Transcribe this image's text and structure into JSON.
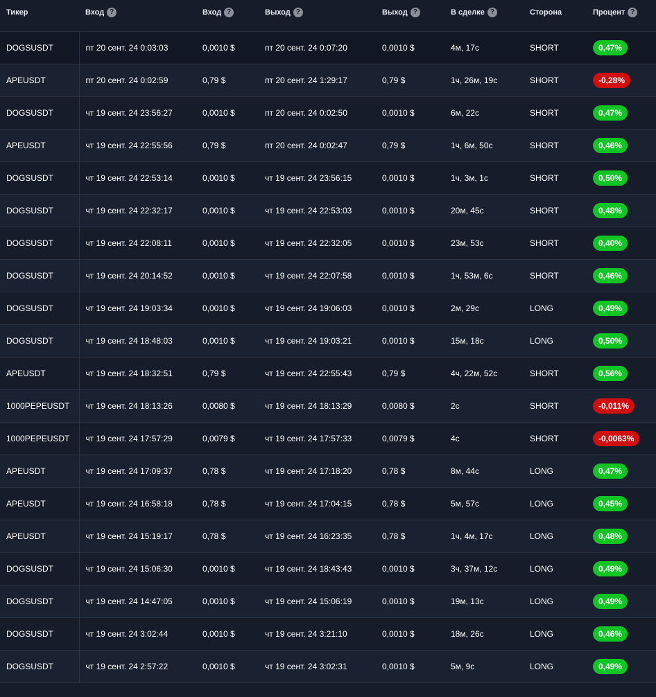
{
  "table": {
    "headers": [
      {
        "label": "Тикер",
        "help": false
      },
      {
        "label": "Вход",
        "help": true
      },
      {
        "label": "Вход",
        "help": true
      },
      {
        "label": "Выход",
        "help": true
      },
      {
        "label": "Выход",
        "help": true
      },
      {
        "label": "В сделке",
        "help": true
      },
      {
        "label": "Сторона",
        "help": false
      },
      {
        "label": "Процент",
        "help": true
      }
    ],
    "help_glyph": "?",
    "colors": {
      "positive": "#11c524",
      "negative": "#d10f0f"
    },
    "rows": [
      {
        "ticker": "DOGSUSDT",
        "entry_time": "пт 20 сент. 24 0:03:03",
        "entry_price": "0,0010 $",
        "exit_time": "пт 20 сент. 24 0:07:20",
        "exit_price": "0,0010 $",
        "duration": "4м, 17с",
        "side": "SHORT",
        "percent": "0,47%",
        "positive": true
      },
      {
        "ticker": "APEUSDT",
        "entry_time": "пт 20 сент. 24 0:02:59",
        "entry_price": "0,79 $",
        "exit_time": "пт 20 сент. 24 1:29:17",
        "exit_price": "0,79 $",
        "duration": "1ч, 26м, 19с",
        "side": "SHORT",
        "percent": "-0,28%",
        "positive": false
      },
      {
        "ticker": "DOGSUSDT",
        "entry_time": "чт 19 сент. 24 23:56:27",
        "entry_price": "0,0010 $",
        "exit_time": "пт 20 сент. 24 0:02:50",
        "exit_price": "0,0010 $",
        "duration": "6м, 22с",
        "side": "SHORT",
        "percent": "0,47%",
        "positive": true
      },
      {
        "ticker": "APEUSDT",
        "entry_time": "чт 19 сент. 24 22:55:56",
        "entry_price": "0,79 $",
        "exit_time": "пт 20 сент. 24 0:02:47",
        "exit_price": "0,79 $",
        "duration": "1ч, 6м, 50с",
        "side": "SHORT",
        "percent": "0,46%",
        "positive": true
      },
      {
        "ticker": "DOGSUSDT",
        "entry_time": "чт 19 сент. 24 22:53:14",
        "entry_price": "0,0010 $",
        "exit_time": "чт 19 сент. 24 23:56:15",
        "exit_price": "0,0010 $",
        "duration": "1ч, 3м, 1с",
        "side": "SHORT",
        "percent": "0,50%",
        "positive": true
      },
      {
        "ticker": "DOGSUSDT",
        "entry_time": "чт 19 сент. 24 22:32:17",
        "entry_price": "0,0010 $",
        "exit_time": "чт 19 сент. 24 22:53:03",
        "exit_price": "0,0010 $",
        "duration": "20м, 45с",
        "side": "SHORT",
        "percent": "0,48%",
        "positive": true
      },
      {
        "ticker": "DOGSUSDT",
        "entry_time": "чт 19 сент. 24 22:08:11",
        "entry_price": "0,0010 $",
        "exit_time": "чт 19 сент. 24 22:32:05",
        "exit_price": "0,0010 $",
        "duration": "23м, 53с",
        "side": "SHORT",
        "percent": "0,40%",
        "positive": true
      },
      {
        "ticker": "DOGSUSDT",
        "entry_time": "чт 19 сент. 24 20:14:52",
        "entry_price": "0,0010 $",
        "exit_time": "чт 19 сент. 24 22:07:58",
        "exit_price": "0,0010 $",
        "duration": "1ч, 53м, 6с",
        "side": "SHORT",
        "percent": "0,46%",
        "positive": true
      },
      {
        "ticker": "DOGSUSDT",
        "entry_time": "чт 19 сент. 24 19:03:34",
        "entry_price": "0,0010 $",
        "exit_time": "чт 19 сент. 24 19:06:03",
        "exit_price": "0,0010 $",
        "duration": "2м, 29с",
        "side": "LONG",
        "percent": "0,49%",
        "positive": true
      },
      {
        "ticker": "DOGSUSDT",
        "entry_time": "чт 19 сент. 24 18:48:03",
        "entry_price": "0,0010 $",
        "exit_time": "чт 19 сент. 24 19:03:21",
        "exit_price": "0,0010 $",
        "duration": "15м, 18с",
        "side": "LONG",
        "percent": "0,50%",
        "positive": true
      },
      {
        "ticker": "APEUSDT",
        "entry_time": "чт 19 сент. 24 18:32:51",
        "entry_price": "0,79 $",
        "exit_time": "чт 19 сент. 24 22:55:43",
        "exit_price": "0,79 $",
        "duration": "4ч, 22м, 52с",
        "side": "SHORT",
        "percent": "0,56%",
        "positive": true
      },
      {
        "ticker": "1000PEPEUSDT",
        "entry_time": "чт 19 сент. 24 18:13:26",
        "entry_price": "0,0080 $",
        "exit_time": "чт 19 сент. 24 18:13:29",
        "exit_price": "0,0080 $",
        "duration": "2с",
        "side": "SHORT",
        "percent": "-0,011%",
        "positive": false
      },
      {
        "ticker": "1000PEPEUSDT",
        "entry_time": "чт 19 сент. 24 17:57:29",
        "entry_price": "0,0079 $",
        "exit_time": "чт 19 сент. 24 17:57:33",
        "exit_price": "0,0079 $",
        "duration": "4с",
        "side": "SHORT",
        "percent": "-0,0063%",
        "positive": false
      },
      {
        "ticker": "APEUSDT",
        "entry_time": "чт 19 сент. 24 17:09:37",
        "entry_price": "0,78 $",
        "exit_time": "чт 19 сент. 24 17:18:20",
        "exit_price": "0,78 $",
        "duration": "8м, 44с",
        "side": "LONG",
        "percent": "0,47%",
        "positive": true
      },
      {
        "ticker": "APEUSDT",
        "entry_time": "чт 19 сент. 24 16:58:18",
        "entry_price": "0,78 $",
        "exit_time": "чт 19 сент. 24 17:04:15",
        "exit_price": "0,78 $",
        "duration": "5м, 57с",
        "side": "LONG",
        "percent": "0,45%",
        "positive": true
      },
      {
        "ticker": "APEUSDT",
        "entry_time": "чт 19 сент. 24 15:19:17",
        "entry_price": "0,78 $",
        "exit_time": "чт 19 сент. 24 16:23:35",
        "exit_price": "0,78 $",
        "duration": "1ч, 4м, 17с",
        "side": "LONG",
        "percent": "0,48%",
        "positive": true
      },
      {
        "ticker": "DOGSUSDT",
        "entry_time": "чт 19 сент. 24 15:06:30",
        "entry_price": "0,0010 $",
        "exit_time": "чт 19 сент. 24 18:43:43",
        "exit_price": "0,0010 $",
        "duration": "3ч, 37м, 12с",
        "side": "LONG",
        "percent": "0,49%",
        "positive": true
      },
      {
        "ticker": "DOGSUSDT",
        "entry_time": "чт 19 сент. 24 14:47:05",
        "entry_price": "0,0010 $",
        "exit_time": "чт 19 сент. 24 15:06:19",
        "exit_price": "0,0010 $",
        "duration": "19м, 13с",
        "side": "LONG",
        "percent": "0,49%",
        "positive": true
      },
      {
        "ticker": "DOGSUSDT",
        "entry_time": "чт 19 сент. 24 3:02:44",
        "entry_price": "0,0010 $",
        "exit_time": "чт 19 сент. 24 3:21:10",
        "exit_price": "0,0010 $",
        "duration": "18м, 26с",
        "side": "LONG",
        "percent": "0,46%",
        "positive": true
      },
      {
        "ticker": "DOGSUSDT",
        "entry_time": "чт 19 сент. 24 2:57:22",
        "entry_price": "0,0010 $",
        "exit_time": "чт 19 сент. 24 3:02:31",
        "exit_price": "0,0010 $",
        "duration": "5м, 9с",
        "side": "LONG",
        "percent": "0,49%",
        "positive": true
      }
    ]
  }
}
